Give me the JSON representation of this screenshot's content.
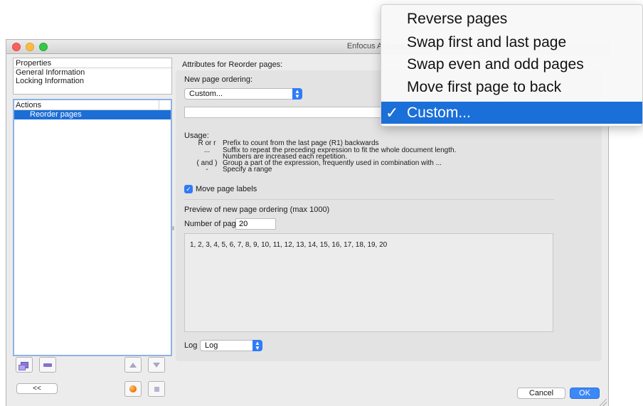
{
  "window": {
    "title": "Enfocus Action List Editor - Untitled (2)"
  },
  "properties_panel": {
    "header": "Properties",
    "items": [
      "General Information",
      "Locking Information"
    ]
  },
  "actions_panel": {
    "header": "Actions",
    "items": [
      "Reorder pages"
    ]
  },
  "left_toolbar": {
    "back_label": "<<"
  },
  "attributes": {
    "title": "Attributes for Reorder pages:",
    "ordering_label": "New page ordering:",
    "ordering_value": "Custom...",
    "custom_expression": "",
    "usage_label": "Usage:",
    "usage": [
      {
        "key": "R or r",
        "desc": "Prefix to count from the last page (R1) backwards"
      },
      {
        "key": "...",
        "desc": "Suffix to repeat the preceding expression to fit the whole document length."
      },
      {
        "key": "",
        "desc": "Numbers are increased each repetition."
      },
      {
        "key": "( and )",
        "desc": "Group a part of the expression, frequently used in combination with ..."
      },
      {
        "key": "-",
        "desc": "Specify a range"
      }
    ],
    "move_labels": {
      "label": "Move page labels",
      "checked": true
    },
    "preview_label": "Preview of new page ordering (max 1000)",
    "num_pages_label": "Number of pages:",
    "num_pages_value": "20",
    "preview_text": "1, 2, 3, 4, 5, 6, 7, 8, 9, 10, 11, 12, 13, 14, 15, 16, 17, 18, 19, 20",
    "log_label": "Log",
    "log_value": "Log"
  },
  "buttons": {
    "cancel": "Cancel",
    "ok": "OK"
  },
  "popup_menu": {
    "items": [
      "Reverse pages",
      "Swap first and last page",
      "Swap even and odd pages",
      "Move first page to back",
      "Custom..."
    ],
    "selected_index": 4,
    "check_glyph": "✓"
  },
  "colors": {
    "selection": "#1b6ed6",
    "accent": "#2f7cf6"
  }
}
